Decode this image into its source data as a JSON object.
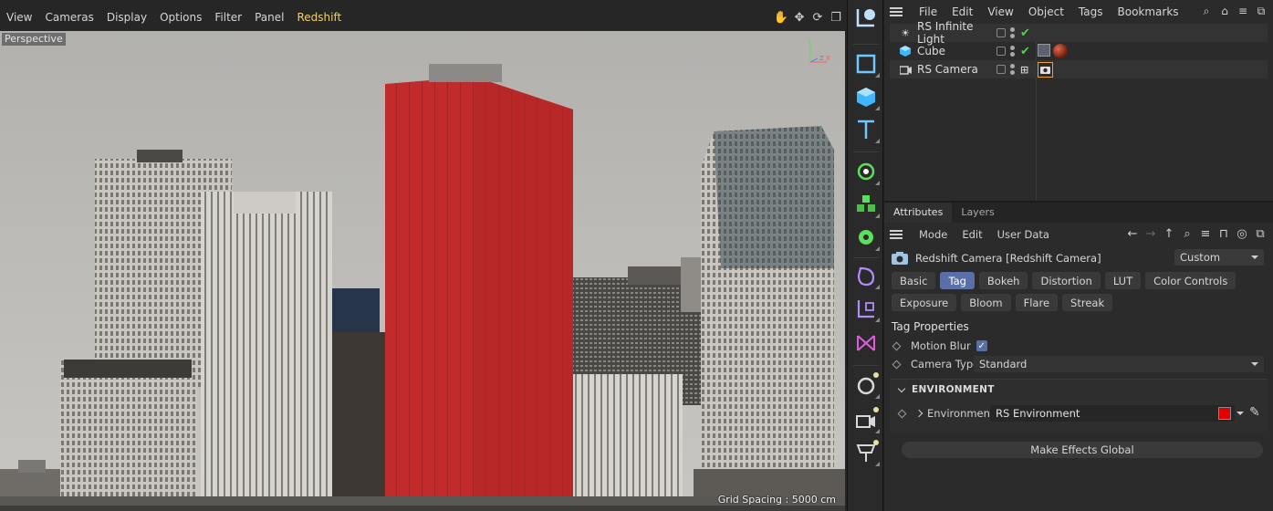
{
  "viewport": {
    "menu": [
      "View",
      "Cameras",
      "Display",
      "Options",
      "Filter",
      "Panel",
      "Redshift"
    ],
    "view_label": "Perspective",
    "grid_spacing": "Grid Spacing : 5000 cm",
    "axis": {
      "y": "Y",
      "z": "Z",
      "x": "X"
    },
    "nav_icons": [
      "move-hand-icon",
      "dolly-icon",
      "rotate-icon",
      "maximize-icon"
    ]
  },
  "toolbar": {
    "tools": [
      "live-selection-icon",
      "rectangle-icon",
      "cube-icon",
      "text-icon",
      "spline-pen-icon",
      "cloner-icon",
      "gear-deformer-icon",
      "field-icon",
      "light-icon",
      "camera-icon",
      "tag-icon",
      "floor-icon",
      "redshift-icon",
      "scene-icon"
    ]
  },
  "object_manager": {
    "menu": [
      "File",
      "Edit",
      "View",
      "Object",
      "Tags",
      "Bookmarks"
    ],
    "objects": [
      {
        "name": "RS Infinite Light"
      },
      {
        "name": "Cube"
      },
      {
        "name": "RS Camera"
      }
    ]
  },
  "attributes": {
    "tabs": [
      "Attributes",
      "Layers"
    ],
    "menu": [
      "Mode",
      "Edit",
      "User Data"
    ],
    "object_name": "Redshift Camera [Redshift Camera]",
    "preset": "Custom",
    "buttons": [
      "Basic",
      "Tag",
      "Bokeh",
      "Distortion",
      "LUT",
      "Color Controls",
      "Exposure",
      "Bloom",
      "Flare",
      "Streak"
    ],
    "active_button": "Tag",
    "section_title": "Tag Properties",
    "motion_blur_label": "Motion Blur",
    "camera_type_label": "Camera Type",
    "camera_type_value": "Standard",
    "env_group": "ENVIRONMENT",
    "env_label": "Environment",
    "env_value": "RS Environment",
    "env_color": "#e00000",
    "make_global": "Make Effects Global"
  },
  "colors": {
    "accent": "#5a6fa8",
    "redshift_menu": "#f0d070",
    "cube_red": "#c62a2a"
  }
}
